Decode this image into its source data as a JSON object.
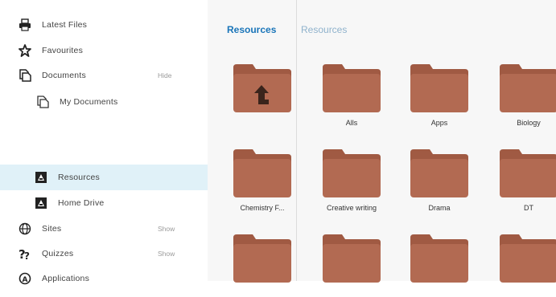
{
  "sidebar": {
    "items": [
      {
        "label": "Latest Files",
        "icon": "printer-icon"
      },
      {
        "label": "Favourites",
        "icon": "star-icon"
      },
      {
        "label": "Documents",
        "icon": "documents-icon",
        "action": "Hide"
      },
      {
        "label": "My Documents",
        "icon": "document-icon"
      },
      {
        "label": "Resources",
        "icon": "network-drive-icon",
        "selected": true
      },
      {
        "label": "Home Drive",
        "icon": "network-drive-icon"
      },
      {
        "label": "Sites",
        "icon": "globe-icon",
        "action": "Show"
      },
      {
        "label": "Quizzes",
        "icon": "quiz-icon",
        "action": "Show"
      },
      {
        "label": "Applications",
        "icon": "applications-icon"
      }
    ]
  },
  "main": {
    "tabs": [
      {
        "label": "Resources",
        "active": true
      },
      {
        "label": "Resources",
        "active": false
      }
    ],
    "folders": [
      {
        "name": "",
        "icon": "folder-up-icon"
      },
      {
        "name": "Alls",
        "icon": "folder-icon"
      },
      {
        "name": "Apps",
        "icon": "folder-icon"
      },
      {
        "name": "Biology",
        "icon": "folder-icon"
      },
      {
        "name": "Chemistry F...",
        "icon": "folder-icon"
      },
      {
        "name": "Creative writing",
        "icon": "folder-icon"
      },
      {
        "name": "Drama",
        "icon": "folder-icon"
      },
      {
        "name": "DT",
        "icon": "folder-icon"
      },
      {
        "name": "",
        "icon": "folder-icon"
      },
      {
        "name": "",
        "icon": "folder-icon"
      },
      {
        "name": "",
        "icon": "folder-icon"
      },
      {
        "name": "",
        "icon": "folder-icon"
      }
    ]
  },
  "colors": {
    "accent": "#1a75b9",
    "selected_bg": "#e0f1f8",
    "folder": "#b26a52"
  }
}
